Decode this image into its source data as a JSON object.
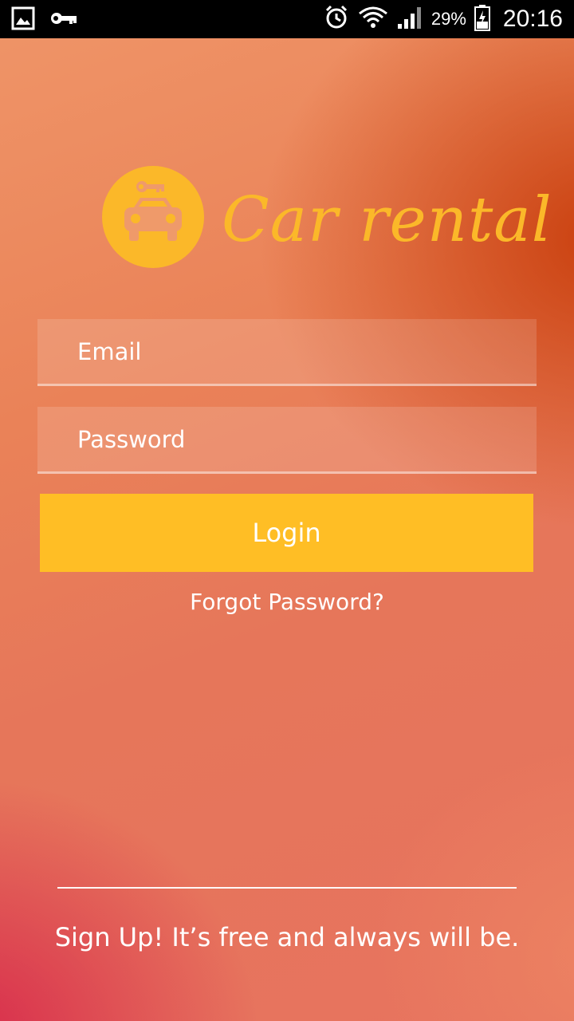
{
  "status_bar": {
    "battery_percent": "29%",
    "time": "20:16",
    "icons_left": [
      "gallery-icon",
      "key-icon"
    ],
    "icons_right": [
      "alarm-icon",
      "wifi-icon",
      "signal-icon",
      "battery-icon"
    ]
  },
  "logo": {
    "text": "Car rental",
    "icon": "car-key-icon",
    "color": "#fbb829"
  },
  "form": {
    "email_placeholder": "Email",
    "password_placeholder": "Password",
    "login_label": "Login",
    "forgot_label": "Forgot Password?"
  },
  "footer": {
    "signup_label": "Sign Up! It’s free and always will be."
  },
  "colors": {
    "accent": "#ffbe25",
    "background_top": "#ef9568",
    "background_corner_tr": "#c83c0a",
    "background_corner_bl": "#d7284b"
  }
}
